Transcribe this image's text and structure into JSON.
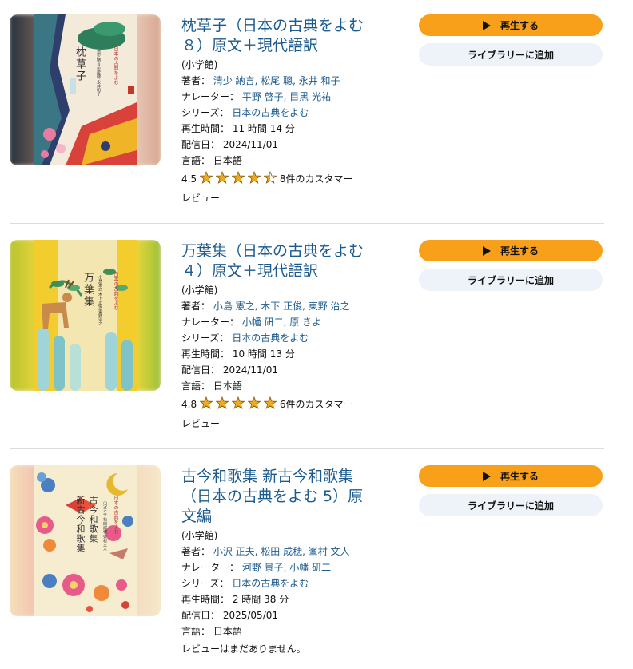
{
  "items": [
    {
      "title": "枕草子（日本の古典をよむ８）原文＋現代語訳",
      "publisher": "(小学館)",
      "author_label": "著者：",
      "authors": "清少 納言, 松尾 聰, 永井 和子",
      "narrator_label": "ナレーター：",
      "narrators": "平野 啓子, 目黒 光祐",
      "series_label": "シリーズ：",
      "series": "日本の古典をよむ",
      "runtime_label": "再生時間：",
      "runtime": "11 時間 14 分",
      "release_label": "配信日：",
      "release": "2024/11/01",
      "language_label": "言語：",
      "language": "日本語",
      "rating": "4.5",
      "stars": [
        1,
        1,
        1,
        1,
        0.5
      ],
      "reviews_line1": "8件のカスタマー",
      "reviews_line2": "レビュー",
      "cover_title": "枕草子",
      "cover_series": "日本の古典をよむ",
      "cover_sub": "清少納言 松尾聰 永井和子",
      "cover_colors": {
        "edge": "#3a3a46",
        "bg": "#f3ead9",
        "accent": "#c8e0e6"
      }
    },
    {
      "title": "万葉集（日本の古典をよむ４）原文＋現代語訳",
      "publisher": "(小学館)",
      "author_label": "著者：",
      "authors": "小島 憲之, 木下 正俊, 東野 治之",
      "narrator_label": "ナレーター：",
      "narrators": "小幡 研二, 原 きよ",
      "series_label": "シリーズ：",
      "series": "日本の古典をよむ",
      "runtime_label": "再生時間：",
      "runtime": "10 時間 13 分",
      "release_label": "配信日：",
      "release": "2024/11/01",
      "language_label": "言語：",
      "language": "日本語",
      "rating": "4.8",
      "stars": [
        1,
        1,
        1,
        1,
        1
      ],
      "reviews_line1": "6件のカスタマー",
      "reviews_line2": "レビュー",
      "cover_title": "万葉集",
      "cover_series": "日本の古典をよむ",
      "cover_sub": "小島憲之 木下正俊 東野治之",
      "cover_colors": {
        "edge": "#d8d02a",
        "bg": "#f1ead2",
        "accent": "#f2cc2e"
      }
    },
    {
      "title": "古今和歌集 新古今和歌集（日本の古典をよむ 5）原文編",
      "publisher": "(小学館)",
      "author_label": "著者：",
      "authors": "小沢 正夫, 松田 成穂, 峯村 文人",
      "narrator_label": "ナレーター：",
      "narrators": "河野 景子, 小幡 研二",
      "series_label": "シリーズ：",
      "series": "日本の古典をよむ",
      "runtime_label": "再生時間：",
      "runtime": "2 時間 38 分",
      "release_label": "配信日：",
      "release": "2025/05/01",
      "language_label": "言語：",
      "language": "日本語",
      "no_reviews": "レビューはまだありません。",
      "cover_title": "古今和歌集",
      "cover_title2": "新古今和歌集",
      "cover_series": "日本の古典をよむ",
      "cover_sub": "小沢正夫 松田成穂 峯村文人",
      "cover_colors": {
        "edge": "#f3d9b0",
        "bg": "#f6ecd0",
        "accent": "#e8523c"
      }
    }
  ],
  "actions": {
    "play_label": "再生する",
    "library_label": "ライブラリーに追加"
  },
  "icons": {
    "play": "play-icon",
    "star_full": "star-icon",
    "star_half": "star-half-icon"
  },
  "colors": {
    "link": "#1d5b8f",
    "play_button": "#f8a01a",
    "library_button": "#eef3f9",
    "star": "#f3a81d"
  }
}
